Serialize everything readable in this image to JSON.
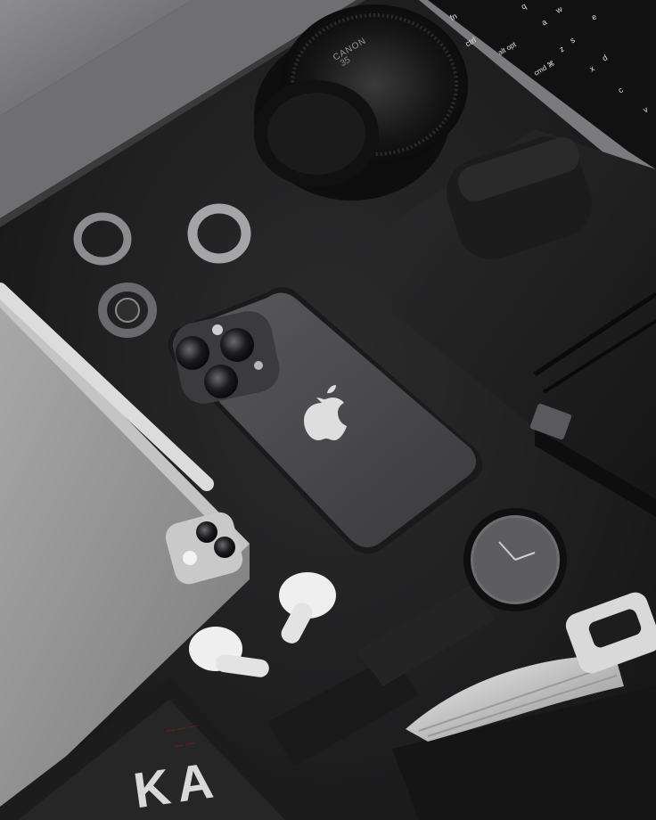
{
  "scene": {
    "description_free": true,
    "items": {
      "laptop_keys": [
        "fn",
        "ctrl",
        "alt opt",
        "cmd ⌘",
        "z",
        "x",
        "c",
        "v",
        "a",
        "s",
        "d",
        "q",
        "w",
        "e"
      ],
      "lens_brand": "CANON",
      "lens_focal": "35",
      "book_letters": "KA",
      "book_small_text": [
        "— — —",
        "— —"
      ]
    }
  },
  "colors": {
    "table": "#1f1f20",
    "phone": "#4a4a4d",
    "tablet": "#9c9c9c",
    "earbuds": "#e6e6e6",
    "wing": "#cfcfd2"
  }
}
